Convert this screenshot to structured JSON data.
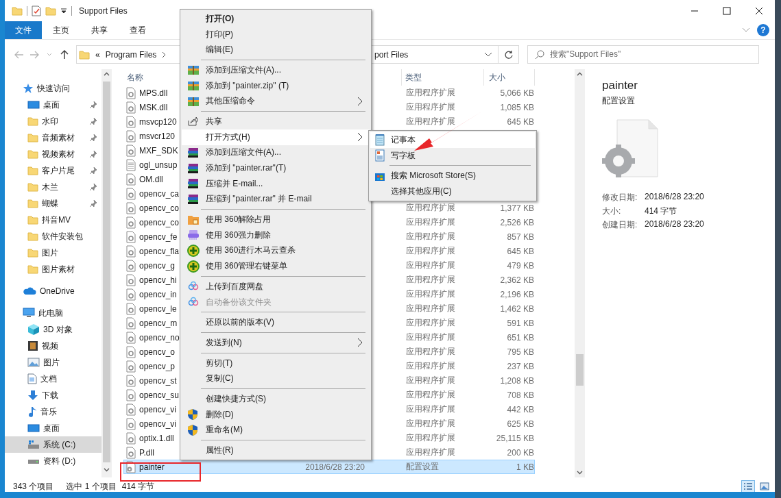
{
  "window": {
    "title": "Support Files"
  },
  "ribbon": {
    "tabs": [
      {
        "label": "文件",
        "selected": true
      },
      {
        "label": "主页",
        "selected": false
      },
      {
        "label": "共享",
        "selected": false
      },
      {
        "label": "查看",
        "selected": false
      }
    ],
    "help": "?"
  },
  "address": {
    "prefix": "«",
    "crumb": "Program Files",
    "tail": "port Files"
  },
  "search": {
    "placeholder": "搜索\"Support Files\""
  },
  "nav": [
    {
      "label": "快速访问",
      "kind": "star",
      "pinned": false,
      "selected": false,
      "children": [
        {
          "label": "桌面",
          "kind": "desktop",
          "pinned": true,
          "selected": false
        },
        {
          "label": "水印",
          "kind": "folder",
          "pinned": true,
          "selected": false
        },
        {
          "label": "音频素材",
          "kind": "folder",
          "pinned": true,
          "selected": false
        },
        {
          "label": "视频素材",
          "kind": "folder",
          "pinned": true,
          "selected": false
        },
        {
          "label": "客户片尾",
          "kind": "folder",
          "pinned": true,
          "selected": false
        },
        {
          "label": "木兰",
          "kind": "folder",
          "pinned": true,
          "selected": false
        },
        {
          "label": "蝴蝶",
          "kind": "folder",
          "pinned": true,
          "selected": false
        },
        {
          "label": "抖音MV",
          "kind": "folder",
          "pinned": false,
          "selected": false
        },
        {
          "label": "软件安装包",
          "kind": "folder",
          "pinned": false,
          "selected": false
        },
        {
          "label": "图片",
          "kind": "folder",
          "pinned": false,
          "selected": false
        },
        {
          "label": "图片素材",
          "kind": "folder",
          "pinned": false,
          "selected": false
        }
      ]
    },
    {
      "label": "OneDrive",
      "kind": "cloud",
      "pinned": false,
      "selected": false
    },
    {
      "label": "此电脑",
      "kind": "pc",
      "pinned": false,
      "selected": false,
      "children": [
        {
          "label": "3D 对象",
          "kind": "cube",
          "pinned": false,
          "selected": false
        },
        {
          "label": "视频",
          "kind": "video",
          "pinned": false,
          "selected": false
        },
        {
          "label": "图片",
          "kind": "pictures",
          "pinned": false,
          "selected": false
        },
        {
          "label": "文档",
          "kind": "docs",
          "pinned": false,
          "selected": false
        },
        {
          "label": "下载",
          "kind": "download",
          "pinned": false,
          "selected": false
        },
        {
          "label": "音乐",
          "kind": "music",
          "pinned": false,
          "selected": false
        },
        {
          "label": "桌面",
          "kind": "desktop",
          "pinned": false,
          "selected": false
        },
        {
          "label": "系统 (C:)",
          "kind": "sysdrive",
          "pinned": false,
          "selected": true
        },
        {
          "label": "资料 (D:)",
          "kind": "drive",
          "pinned": false,
          "selected": false
        }
      ]
    }
  ],
  "list": {
    "columns": {
      "name": "名称",
      "type": "类型",
      "size": "大小"
    },
    "rows": [
      {
        "name": "MPS.dll",
        "kind": "dll",
        "type": "应用程序扩展",
        "size": "5,066 KB",
        "selected": false
      },
      {
        "name": "MSK.dll",
        "kind": "dll",
        "type": "应用程序扩展",
        "size": "1,085 KB",
        "selected": false
      },
      {
        "name": "msvcp120",
        "kind": "dll",
        "type": "应用程序扩展",
        "size": "645 KB",
        "selected": false
      },
      {
        "name": "msvcr120",
        "kind": "dll",
        "selected": false
      },
      {
        "name": "MXF_SDK",
        "kind": "dll",
        "selected": false
      },
      {
        "name": "ogl_unsup",
        "kind": "text",
        "selected": false
      },
      {
        "name": "OM.dll",
        "kind": "dll",
        "selected": false
      },
      {
        "name": "opencv_ca",
        "kind": "dll",
        "selected": false
      },
      {
        "name": "opencv_co",
        "kind": "dll",
        "type": "应用程序扩展",
        "size": "1,377 KB",
        "selected": false
      },
      {
        "name": "opencv_co",
        "kind": "dll",
        "type": "应用程序扩展",
        "size": "2,526 KB",
        "selected": false
      },
      {
        "name": "opencv_fe",
        "kind": "dll",
        "type": "应用程序扩展",
        "size": "857 KB",
        "selected": false
      },
      {
        "name": "opencv_fla",
        "kind": "dll",
        "type": "应用程序扩展",
        "size": "645 KB",
        "selected": false
      },
      {
        "name": "opencv_g",
        "kind": "dll",
        "type": "应用程序扩展",
        "size": "479 KB",
        "selected": false
      },
      {
        "name": "opencv_hi",
        "kind": "dll",
        "type": "应用程序扩展",
        "size": "2,362 KB",
        "selected": false
      },
      {
        "name": "opencv_in",
        "kind": "dll",
        "type": "应用程序扩展",
        "size": "2,196 KB",
        "selected": false
      },
      {
        "name": "opencv_le",
        "kind": "dll",
        "type": "应用程序扩展",
        "size": "1,462 KB",
        "selected": false
      },
      {
        "name": "opencv_m",
        "kind": "dll",
        "type": "应用程序扩展",
        "size": "591 KB",
        "selected": false
      },
      {
        "name": "opencv_no",
        "kind": "dll",
        "type": "应用程序扩展",
        "size": "651 KB",
        "selected": false
      },
      {
        "name": "opencv_o",
        "kind": "dll",
        "type": "应用程序扩展",
        "size": "795 KB",
        "selected": false
      },
      {
        "name": "opencv_p",
        "kind": "dll",
        "type": "应用程序扩展",
        "size": "237 KB",
        "selected": false
      },
      {
        "name": "opencv_st",
        "kind": "dll",
        "type": "应用程序扩展",
        "size": "1,208 KB",
        "selected": false
      },
      {
        "name": "opencv_su",
        "kind": "dll",
        "type": "应用程序扩展",
        "size": "708 KB",
        "selected": false
      },
      {
        "name": "opencv_vi",
        "kind": "dll",
        "type": "应用程序扩展",
        "size": "442 KB",
        "selected": false
      },
      {
        "name": "opencv_vi",
        "kind": "dll",
        "type": "应用程序扩展",
        "size": "625 KB",
        "selected": false
      },
      {
        "name": "optix.1.dll",
        "kind": "dll",
        "type": "应用程序扩展",
        "size": "25,115 KB",
        "selected": false
      },
      {
        "name": "P.dll",
        "kind": "dll",
        "type": "应用程序扩展",
        "size": "200 KB",
        "selected": false
      },
      {
        "name": "painter",
        "kind": "config",
        "date": "2018/6/28 23:20",
        "type": "配置设置",
        "size": "1 KB",
        "selected": true
      }
    ]
  },
  "preview": {
    "title": "painter",
    "subtitle": "配置设置",
    "details": [
      {
        "label": "修改日期:",
        "value": "2018/6/28 23:20"
      },
      {
        "label": "大小:",
        "value": "414 字节"
      },
      {
        "label": "创建日期:",
        "value": "2018/6/28 23:20"
      }
    ]
  },
  "status": {
    "count": "343 个项目",
    "selection": "选中 1 个项目",
    "size": "414 字节",
    "views": [
      {
        "kind": "details",
        "selected": true
      },
      {
        "kind": "thumbnails",
        "selected": false
      }
    ]
  },
  "menu": {
    "groups": [
      [
        {
          "label": "打开(O)",
          "kind": "none",
          "default": true,
          "disabled": false,
          "submenu": false,
          "selected": false
        },
        {
          "label": "打印(P)",
          "kind": "none",
          "default": false,
          "disabled": false,
          "submenu": false,
          "selected": false
        },
        {
          "label": "编辑(E)",
          "kind": "none",
          "default": false,
          "disabled": false,
          "submenu": false,
          "selected": false
        }
      ],
      [
        {
          "label": "添加到压缩文件(A)...",
          "kind": "zip",
          "default": false,
          "disabled": false,
          "submenu": false,
          "selected": false
        },
        {
          "label": "添加到 \"painter.zip\" (T)",
          "kind": "zip",
          "default": false,
          "disabled": false,
          "submenu": false,
          "selected": false
        },
        {
          "label": "其他压缩命令",
          "kind": "zip",
          "default": false,
          "disabled": false,
          "submenu": true,
          "selected": false
        }
      ],
      [
        {
          "label": "共享",
          "kind": "share",
          "default": false,
          "disabled": false,
          "submenu": false,
          "selected": false
        },
        {
          "label": "打开方式(H)",
          "kind": "none",
          "default": false,
          "disabled": false,
          "submenu": true,
          "selected": true
        },
        {
          "label": "添加到压缩文件(A)...",
          "kind": "rar",
          "default": false,
          "disabled": false,
          "submenu": false,
          "selected": false
        },
        {
          "label": "添加到 \"painter.rar\"(T)",
          "kind": "rar",
          "default": false,
          "disabled": false,
          "submenu": false,
          "selected": false
        },
        {
          "label": "压缩并 E-mail...",
          "kind": "rar",
          "default": false,
          "disabled": false,
          "submenu": false,
          "selected": false
        },
        {
          "label": "压缩到 \"painter.rar\" 并 E-mail",
          "kind": "rar",
          "default": false,
          "disabled": false,
          "submenu": false,
          "selected": false
        }
      ],
      [
        {
          "label": "使用 360解除占用",
          "kind": "unlock",
          "default": false,
          "disabled": false,
          "submenu": false,
          "selected": false
        },
        {
          "label": "使用 360强力删除",
          "kind": "shred",
          "default": false,
          "disabled": false,
          "submenu": false,
          "selected": false
        },
        {
          "label": "使用 360进行木马云查杀",
          "kind": "plus",
          "default": false,
          "disabled": false,
          "submenu": false,
          "selected": false
        },
        {
          "label": "使用 360管理右键菜单",
          "kind": "plus",
          "default": false,
          "disabled": false,
          "submenu": false,
          "selected": false
        }
      ],
      [
        {
          "label": "上传到百度网盘",
          "kind": "baidu",
          "default": false,
          "disabled": false,
          "submenu": false,
          "selected": false
        },
        {
          "label": "自动备份该文件夹",
          "kind": "baidu",
          "default": false,
          "disabled": true,
          "submenu": false,
          "selected": false
        }
      ],
      [
        {
          "label": "还原以前的版本(V)",
          "kind": "none",
          "default": false,
          "disabled": false,
          "submenu": false,
          "selected": false
        }
      ],
      [
        {
          "label": "发送到(N)",
          "kind": "none",
          "default": false,
          "disabled": false,
          "submenu": true,
          "selected": false
        }
      ],
      [
        {
          "label": "剪切(T)",
          "kind": "none",
          "default": false,
          "disabled": false,
          "submenu": false,
          "selected": false
        },
        {
          "label": "复制(C)",
          "kind": "none",
          "default": false,
          "disabled": false,
          "submenu": false,
          "selected": false
        }
      ],
      [
        {
          "label": "创建快捷方式(S)",
          "kind": "none",
          "default": false,
          "disabled": false,
          "submenu": false,
          "selected": false
        },
        {
          "label": "删除(D)",
          "kind": "shield",
          "default": false,
          "disabled": false,
          "submenu": false,
          "selected": false
        },
        {
          "label": "重命名(M)",
          "kind": "shield",
          "default": false,
          "disabled": false,
          "submenu": false,
          "selected": false
        }
      ],
      [
        {
          "label": "属性(R)",
          "kind": "none",
          "default": false,
          "disabled": false,
          "submenu": false,
          "selected": false
        }
      ]
    ]
  },
  "submenu": {
    "groups": [
      [
        {
          "label": "记事本",
          "kind": "notepad",
          "selected": true
        },
        {
          "label": "写字板",
          "kind": "wordpad",
          "selected": false
        }
      ],
      [
        {
          "label": "搜索 Microsoft Store(S)",
          "kind": "store",
          "selected": false
        },
        {
          "label": "选择其他应用(C)",
          "kind": "none",
          "selected": false
        }
      ]
    ]
  }
}
